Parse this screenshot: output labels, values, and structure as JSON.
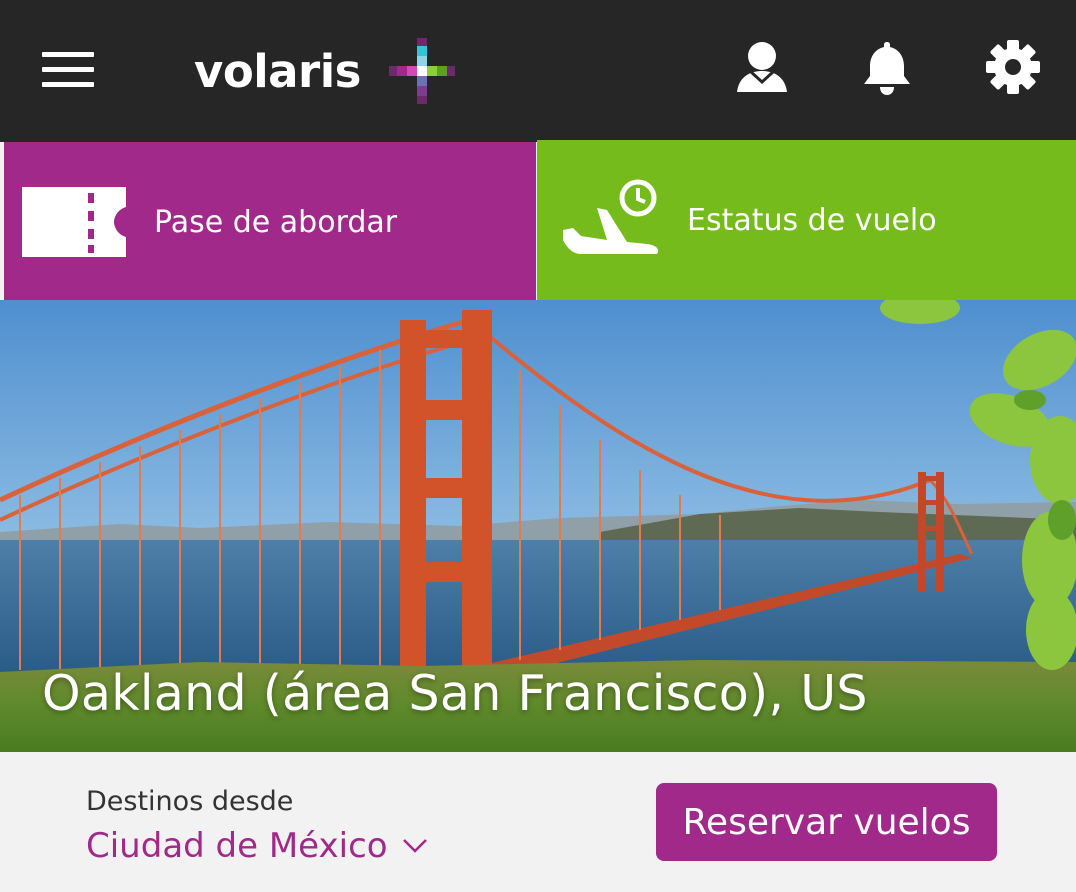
{
  "header": {
    "logo_text": "volaris",
    "icons": [
      "hamburger-menu-icon",
      "user-icon",
      "bell-icon",
      "gear-icon"
    ]
  },
  "actions": {
    "boarding_pass": {
      "label": "Pase de abordar",
      "icon": "ticket-icon",
      "color": "#a1298a"
    },
    "flight_status": {
      "label": "Estatus de vuelo",
      "icon": "plane-clock-icon",
      "color": "#76bb1c"
    }
  },
  "hero": {
    "destination": "Oakland (área San Francisco), US"
  },
  "booking": {
    "destinations_label": "Destinos desde",
    "origin_city": "Ciudad de México",
    "book_button": "Reservar vuelos",
    "accent_color": "#a1298a"
  }
}
